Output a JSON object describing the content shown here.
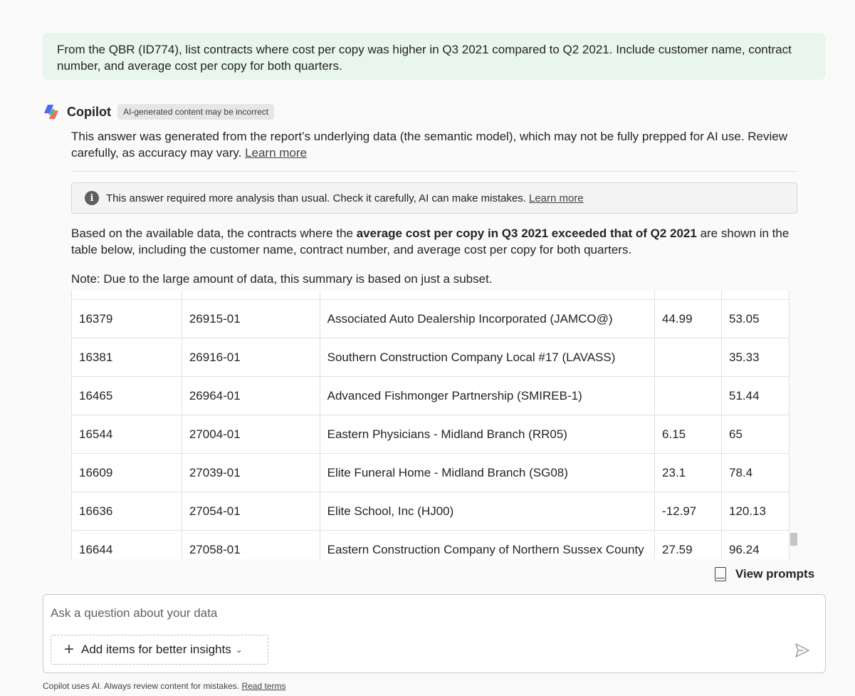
{
  "user_message": "From the QBR (ID774), list contracts where cost per copy was higher in Q3 2021 compared to Q2 2021. Include customer name, contract number, and average cost per copy for both quarters.",
  "copilot": {
    "name": "Copilot",
    "badge": "AI-generated content may be incorrect"
  },
  "disclaimer": {
    "text": "This answer was generated from the report’s underlying data (the semantic model), which may not be fully prepped for AI use. Review carefully, as accuracy may vary.",
    "link": "Learn more"
  },
  "warning": {
    "icon": "info-icon",
    "text": "This answer required more analysis than usual. Check it carefully, AI can make mistakes.",
    "link": "Learn more"
  },
  "answer": {
    "before": "Based on the available data, the contracts where the ",
    "bold": "average cost per copy in Q3 2021 exceeded that of Q2 2021",
    "after": " are shown in the table below, including the customer name, contract number, and average cost per copy for both quarters."
  },
  "note": "Note: Due to the large amount of data, this summary is based on just a subset.",
  "table": {
    "rows": [
      {
        "id": "16379",
        "contract": "26915-01",
        "customer": "Associated Auto Dealership Incorporated (JAMCO@)",
        "q2": "44.99",
        "q3": "53.05"
      },
      {
        "id": "16381",
        "contract": "26916-01",
        "customer": "Southern Construction Company Local #17 (LAVASS)",
        "q2": "",
        "q3": "35.33"
      },
      {
        "id": "16465",
        "contract": "26964-01",
        "customer": "Advanced Fishmonger Partnership (SMIREB-1)",
        "q2": "",
        "q3": "51.44"
      },
      {
        "id": "16544",
        "contract": "27004-01",
        "customer": "Eastern Physicians - Midland Branch (RR05)",
        "q2": "6.15",
        "q3": "65"
      },
      {
        "id": "16609",
        "contract": "27039-01",
        "customer": "Elite Funeral Home - Midland Branch (SG08)",
        "q2": "23.1",
        "q3": "78.4"
      },
      {
        "id": "16636",
        "contract": "27054-01",
        "customer": "Elite School, Inc (HJ00)",
        "q2": "-12.97",
        "q3": "120.13"
      },
      {
        "id": "16644",
        "contract": "27058-01",
        "customer": "Eastern Construction Company of Northern Sussex County",
        "q2": "27.59",
        "q3": "96.24"
      }
    ]
  },
  "view_prompts": "View prompts",
  "input": {
    "placeholder": "Ask a question about your data",
    "add_items": "Add items for better insights"
  },
  "footer": {
    "text": "Copilot uses AI. Always review content for mistakes.",
    "link": "Read terms"
  }
}
